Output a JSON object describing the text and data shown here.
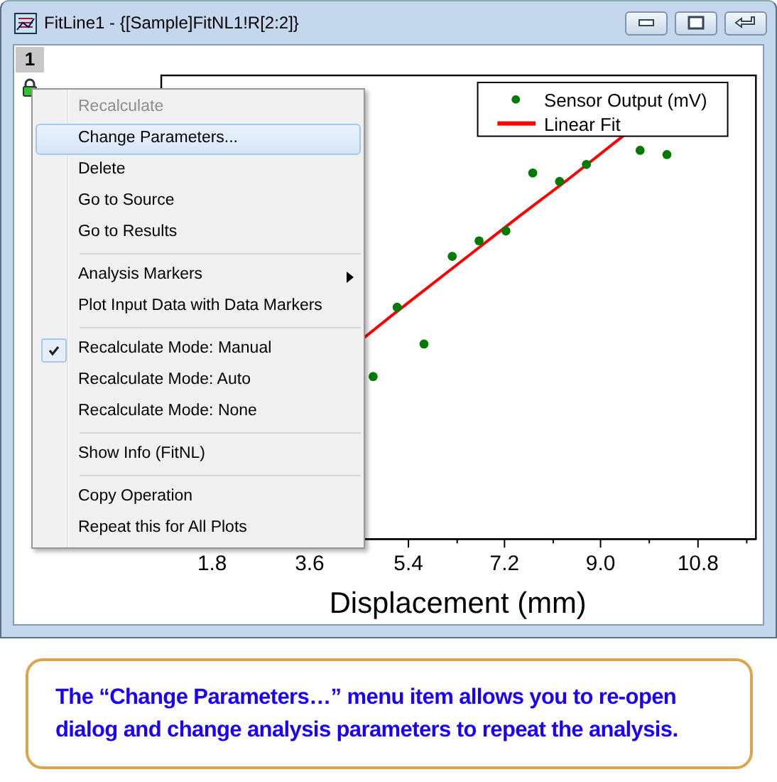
{
  "window": {
    "title": "FitLine1 - {[Sample]FitNL1!R[2:2]}"
  },
  "layer_tabs": [
    {
      "label": "1",
      "selected": true
    }
  ],
  "graph": {
    "legend": [
      {
        "label": "Sensor Output (mV)",
        "kind": "marker",
        "color": "#007a00"
      },
      {
        "label": "Linear Fit",
        "kind": "line",
        "color": "#ff0000"
      }
    ],
    "x_tick_labels": [
      "1.8",
      "3.6",
      "5.4",
      "7.2",
      "9.0",
      "10.8"
    ],
    "x_axis_title": "Displacement (mm)"
  },
  "context_menu": [
    {
      "kind": "item",
      "label": "Recalculate",
      "disabled": true,
      "selected": false,
      "checked": false,
      "has_submenu": false
    },
    {
      "kind": "item",
      "label": "Change Parameters...",
      "disabled": false,
      "selected": true,
      "checked": false,
      "has_submenu": false
    },
    {
      "kind": "item",
      "label": "Delete",
      "disabled": false,
      "selected": false,
      "checked": false,
      "has_submenu": false
    },
    {
      "kind": "item",
      "label": "Go to Source",
      "disabled": false,
      "selected": false,
      "checked": false,
      "has_submenu": false
    },
    {
      "kind": "item",
      "label": "Go to Results",
      "disabled": false,
      "selected": false,
      "checked": false,
      "has_submenu": false
    },
    {
      "kind": "separator"
    },
    {
      "kind": "item",
      "label": "Analysis Markers",
      "disabled": false,
      "selected": false,
      "checked": false,
      "has_submenu": true
    },
    {
      "kind": "item",
      "label": "Plot Input Data with Data Markers",
      "disabled": false,
      "selected": false,
      "checked": false,
      "has_submenu": false
    },
    {
      "kind": "separator"
    },
    {
      "kind": "item",
      "label": "Recalculate Mode: Manual",
      "disabled": false,
      "selected": false,
      "checked": true,
      "has_submenu": false
    },
    {
      "kind": "item",
      "label": "Recalculate Mode: Auto",
      "disabled": false,
      "selected": false,
      "checked": false,
      "has_submenu": false
    },
    {
      "kind": "item",
      "label": "Recalculate Mode: None",
      "disabled": false,
      "selected": false,
      "checked": false,
      "has_submenu": false
    },
    {
      "kind": "separator"
    },
    {
      "kind": "item",
      "label": "Show Info (FitNL)",
      "disabled": false,
      "selected": false,
      "checked": false,
      "has_submenu": false
    },
    {
      "kind": "separator"
    },
    {
      "kind": "item",
      "label": "Copy Operation",
      "disabled": false,
      "selected": false,
      "checked": false,
      "has_submenu": false
    },
    {
      "kind": "item",
      "label": "Repeat this for All Plots",
      "disabled": false,
      "selected": false,
      "checked": false,
      "has_submenu": false
    }
  ],
  "callout": {
    "text": "The “Change Parameters…” menu item allows you to re-open dialog and change analysis parameters to repeat the analysis."
  }
}
